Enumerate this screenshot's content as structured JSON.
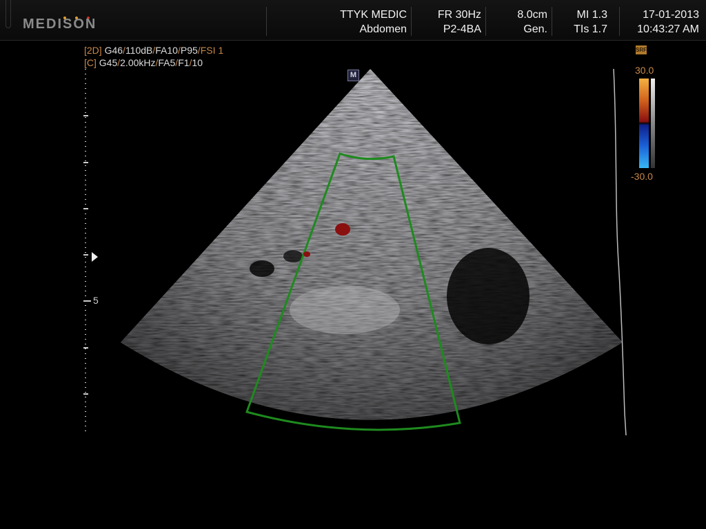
{
  "header": {
    "brand": "MEDISON",
    "brand_dot_colors": [
      "#e0a030",
      "#e0a030",
      "#d03020"
    ],
    "institution": "TTYK MEDIC",
    "exam": "Abdomen",
    "frame_rate": "FR 30Hz",
    "probe": "P2-4BA",
    "depth": "8.0cm",
    "mode": "Gen.",
    "mi": "MI 1.3",
    "tis": "TIs 1.7",
    "date": "17-01-2013",
    "time": "10:43:27 AM"
  },
  "params": {
    "line1_tag": "[2D]",
    "line1_segments": [
      "G46",
      "/",
      "110dB",
      "/",
      "FA10",
      "/",
      "P95",
      "/",
      "FSI 1"
    ],
    "line2_tag": "[C]",
    "line2_segments": [
      "G45",
      "/",
      "2.00kHz",
      "/",
      "FA5",
      "/",
      "F1",
      "/",
      "10"
    ]
  },
  "image": {
    "marker": "M",
    "depth_label": "5",
    "colors": {
      "roi_box": "#1e8a1e",
      "doppler_flow": "#8a1010",
      "scale_orange": "#c8884a"
    }
  },
  "color_scale": {
    "badge": "SRF",
    "max": "30.0",
    "min": "-30.0"
  }
}
